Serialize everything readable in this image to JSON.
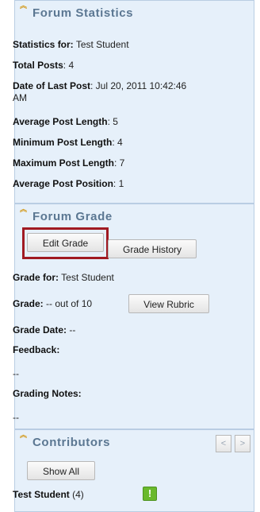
{
  "statistics": {
    "title": "Forum Statistics",
    "statistics_for_label": "Statistics for:",
    "statistics_for_value": "Test Student",
    "total_posts_label": "Total Posts",
    "total_posts_value": ": 4",
    "date_last_post_label": "Date of Last Post",
    "date_last_post_value": ": Jul 20, 2011 10:42:46",
    "date_last_post_value_cont": "AM",
    "avg_post_length_label": "Average Post Length",
    "avg_post_length_value": ": 5",
    "min_post_length_label": "Minimum Post Length",
    "min_post_length_value": ": 4",
    "max_post_length_label": "Maximum Post Length",
    "max_post_length_value": ": 7",
    "avg_post_position_label": "Average Post Position",
    "avg_post_position_value": ": 1"
  },
  "grade": {
    "title": "Forum Grade",
    "edit_grade_label": "Edit Grade",
    "grade_history_label": "Grade History",
    "grade_for_label": "Grade for:",
    "grade_for_value": "Test Student",
    "grade_label": "Grade:",
    "grade_value": "-- out of 10",
    "view_rubric_label": "View Rubric",
    "grade_date_label": "Grade Date:",
    "grade_date_value": "--",
    "feedback_label": "Feedback:",
    "feedback_value": "--",
    "grading_notes_label": "Grading Notes:",
    "grading_notes_value": "--"
  },
  "contributors": {
    "title": "Contributors",
    "prev_icon": "<",
    "next_icon": ">",
    "show_all_label": "Show All",
    "student_name": "Test Student",
    "student_count": "(4)",
    "badge_icon": "!"
  },
  "colors": {
    "panel_bg": "#e6f0fa",
    "title_color": "#5b7792",
    "highlight_border": "#a01a22",
    "badge_green": "#6ab92c"
  }
}
